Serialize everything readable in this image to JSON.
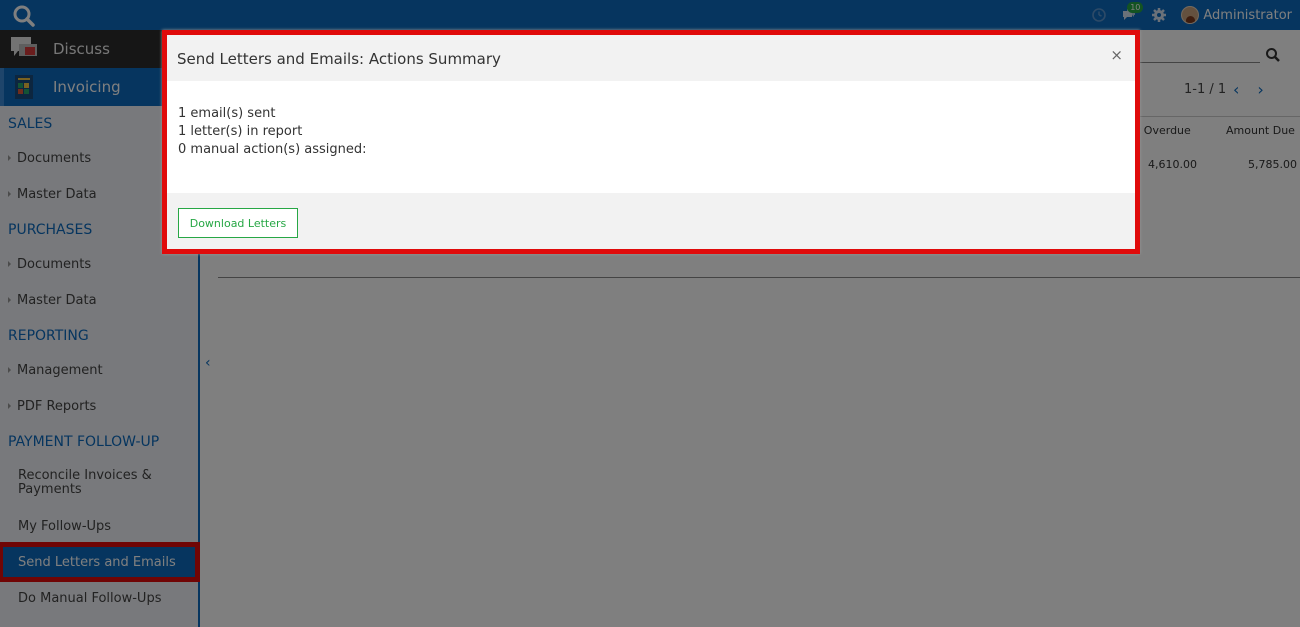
{
  "topbar": {
    "user_name": "Administrator",
    "chat_badge": "10",
    "accent": "#0c6bbf"
  },
  "sidebar": {
    "apps": [
      {
        "label": "Discuss"
      },
      {
        "label": "Invoicing"
      }
    ],
    "sections": {
      "sales": "SALES",
      "purchases": "PURCHASES",
      "reporting": "REPORTING",
      "followup": "PAYMENT FOLLOW-UP"
    },
    "items": {
      "sales_documents": "Documents",
      "sales_master": "Master Data",
      "purch_documents": "Documents",
      "purch_master": "Master Data",
      "management": "Management",
      "pdf_reports": "PDF Reports",
      "reconcile": "Reconcile Invoices & Payments",
      "my_followups": "My Follow-Ups",
      "send_letters": "Send Letters and Emails",
      "manual_followups": "Do Manual Follow-Ups"
    }
  },
  "main": {
    "pager": "1-1 / 1",
    "columns": {
      "overdue": "t Overdue",
      "amount_due": "Amount Due"
    },
    "row": {
      "overdue": "4,610.00",
      "amount_due": "5,785.00"
    }
  },
  "modal": {
    "title": "Send Letters and Emails: Actions Summary",
    "close": "×",
    "lines": [
      "1 email(s) sent",
      "1 letter(s) in report",
      "0 manual action(s) assigned:"
    ],
    "download_button": "Download Letters"
  }
}
